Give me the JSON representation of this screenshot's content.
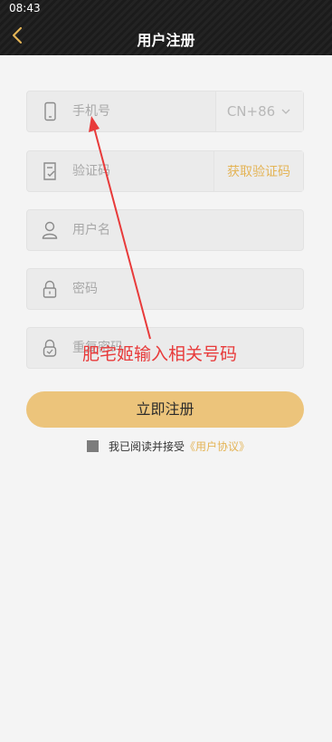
{
  "status": {
    "time": "08:43"
  },
  "header": {
    "title": "用户注册"
  },
  "form": {
    "phone_placeholder": "手机号",
    "country_code": "CN+86",
    "code_placeholder": "验证码",
    "get_code_label": "获取验证码",
    "username_placeholder": "用户名",
    "password_placeholder": "密码",
    "confirm_placeholder": "重复密码"
  },
  "register_label": "立即注册",
  "agreement": {
    "text": "我已阅读并接受",
    "link": "《用户协议》"
  },
  "annotation": {
    "text": "肥宅姬输入相关号码"
  },
  "colors": {
    "accent": "#ecc47b",
    "link": "#e4b456",
    "annotation": "#e83a3a",
    "header": "#1e1e1e"
  },
  "icons": [
    "chevron-left-icon",
    "phone-icon",
    "verify-code-icon",
    "user-icon",
    "lock-icon",
    "lock-confirm-icon",
    "chevron-down-icon"
  ]
}
